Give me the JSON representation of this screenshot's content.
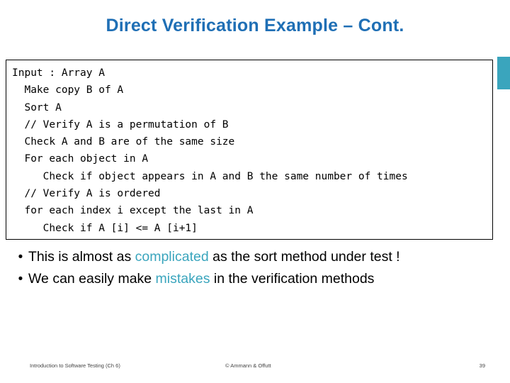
{
  "slide": {
    "title": "Direct Verification Example – Cont.",
    "accent_color": "#3aa5bd",
    "title_color": "#1f6fb5"
  },
  "code_block": {
    "lines": [
      "Input : Array A",
      "  Make copy B of A",
      "  Sort A",
      "  // Verify A is a permutation of B",
      "  Check A and B are of the same size",
      "  For each object in A",
      "     Check if object appears in A and B the same number of times",
      "  // Verify A is ordered",
      "  for each index i except the last in A",
      "     Check if A [i] <= A [i+1]"
    ]
  },
  "bullets": [
    {
      "marker": "•",
      "text_before": "This is almost as ",
      "highlight": "complicated",
      "text_after": " as the sort method under test !"
    },
    {
      "marker": "•",
      "text_before": "We can easily make ",
      "highlight": "mistakes",
      "text_after": " in the verification methods"
    }
  ],
  "footer": {
    "left": "Introduction to Software Testing (Ch 6)",
    "center": "© Ammann & Offutt",
    "right": "39"
  }
}
